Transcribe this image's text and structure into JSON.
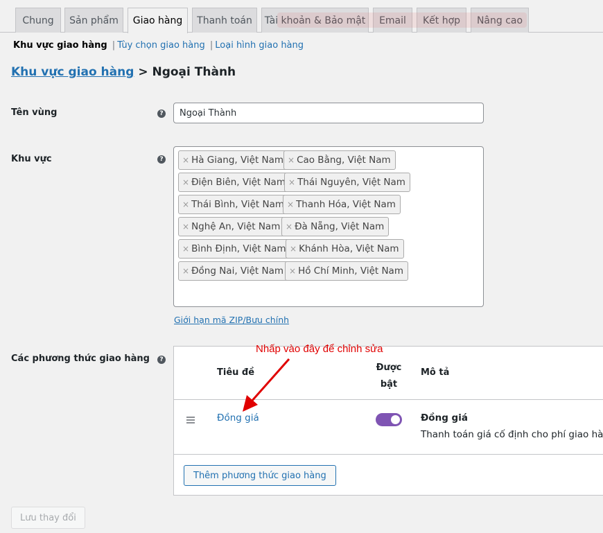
{
  "tabs": [
    {
      "label": "Chung"
    },
    {
      "label": "Sản phẩm"
    },
    {
      "label": "Giao hàng"
    },
    {
      "label": "Thanh toán"
    },
    {
      "label": "Tài khoản & Bảo mật"
    },
    {
      "label": "Email"
    },
    {
      "label": "Kết hợp"
    },
    {
      "label": "Nâng cao"
    }
  ],
  "active_tab": "Giao hàng",
  "subnav": {
    "current": "Khu vực giao hàng",
    "links": [
      "Tùy chọn giao hàng",
      "Loại hình giao hàng"
    ],
    "separator": "|"
  },
  "breadcrumb": {
    "link": "Khu vực giao hàng",
    "separator": ">",
    "current": "Ngoại Thành"
  },
  "form": {
    "zone_name_label": "Tên vùng",
    "zone_name_value": "Ngoại Thành",
    "regions_label": "Khu vực",
    "regions": [
      "Hà Giang, Việt Nam",
      "Cao Bằng, Việt Nam",
      "Điện Biên, Việt Nam",
      "Thái Nguyên, Việt Nam",
      "Thái Bình, Việt Nam",
      "Thanh Hóa, Việt Nam",
      "Nghệ An, Việt Nam",
      "Đà Nẵng, Việt Nam",
      "Bình Định, Việt Nam",
      "Khánh Hòa, Việt Nam",
      "Đồng Nai, Việt Nam",
      "Hồ Chí Minh, Việt Nam"
    ],
    "chip_remove_glyph": "×",
    "zip_link": "Giới hạn mã ZIP/Bưu chính",
    "methods_label": "Các phương thức giao hàng",
    "help_glyph": "?"
  },
  "methods_table": {
    "col_title": "Tiêu đề",
    "col_enabled_line1": "Được",
    "col_enabled_line2": "bật",
    "col_description": "Mô tả",
    "rows": [
      {
        "title": "Đồng giá",
        "enabled": true,
        "desc_title": "Đồng giá",
        "desc_text": "Thanh toán giá cố định cho phí giao hàng."
      }
    ],
    "add_button": "Thêm phương thức giao hàng"
  },
  "save_button": "Lưu thay đổi",
  "annotation": "Nhấp vào đây để chỉnh sửa",
  "colors": {
    "link": "#2271b1",
    "toggle_on": "#7f54b3",
    "annotation": "#e00000"
  }
}
